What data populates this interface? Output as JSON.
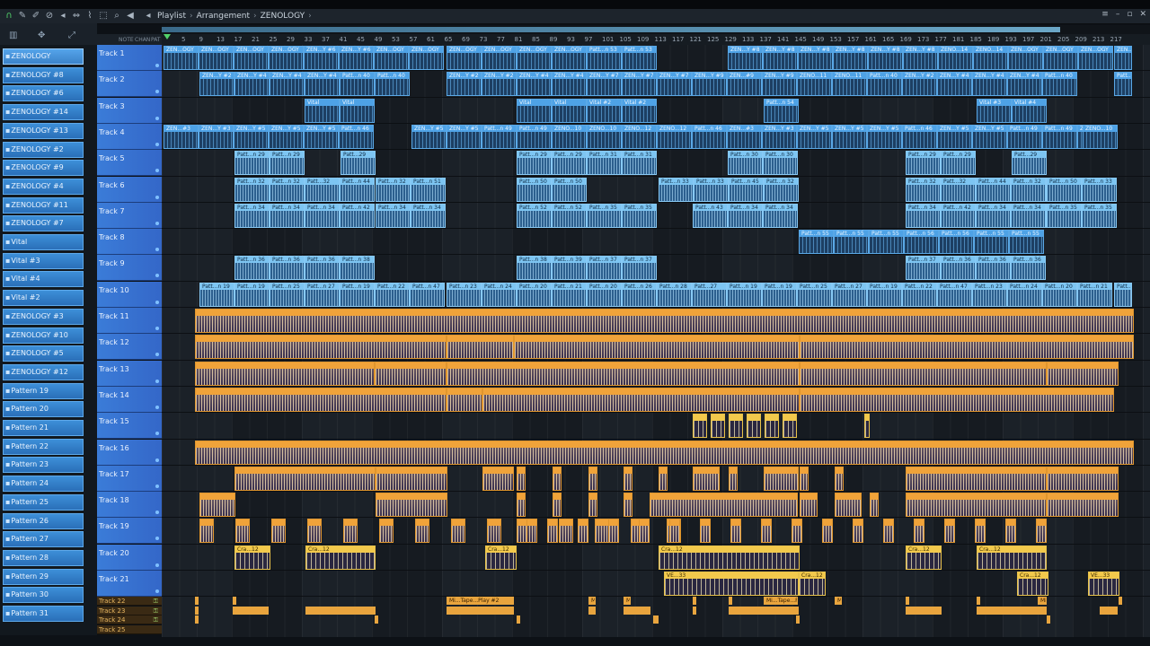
{
  "toolbar": {
    "breadcrumb": [
      "Playlist",
      "Arrangement",
      "ZENOLOGY"
    ],
    "icons": [
      "magnet-icon",
      "draw-icon",
      "paint-icon",
      "delete-icon",
      "mute-icon",
      "slip-icon",
      "slice-icon",
      "select-icon",
      "zoom-icon",
      "playback-icon"
    ]
  },
  "header_left": {
    "labels": [
      "NOTE",
      "CHAN",
      "PAT"
    ]
  },
  "ruler": {
    "ticks": [
      "5",
      "9",
      "13",
      "17",
      "21",
      "25",
      "29",
      "33",
      "37",
      "41",
      "45",
      "49",
      "53",
      "57",
      "61",
      "65",
      "69",
      "73",
      "77",
      "81",
      "85",
      "89",
      "93",
      "97",
      "101",
      "105",
      "109",
      "113",
      "117",
      "121",
      "125",
      "129",
      "133",
      "137",
      "141",
      "145",
      "149",
      "153",
      "157",
      "161",
      "165",
      "169",
      "173",
      "177",
      "181",
      "185",
      "189",
      "193",
      "197",
      "201",
      "205",
      "209",
      "213",
      "217"
    ]
  },
  "browser": {
    "items": [
      "ZENOLOGY",
      "ZENOLOGY #8",
      "ZENOLOGY #6",
      "ZENOLOGY #14",
      "ZENOLOGY #13",
      "ZENOLOGY #2",
      "ZENOLOGY #9",
      "ZENOLOGY #4",
      "ZENOLOGY #11",
      "ZENOLOGY #7",
      "Vital",
      "Vital #3",
      "Vital #4",
      "Vital #2",
      "ZENOLOGY #3",
      "ZENOLOGY #10",
      "ZENOLOGY #5",
      "ZENOLOGY #12",
      "Pattern 19",
      "Pattern 20",
      "Pattern 21",
      "Pattern 22",
      "Pattern 23",
      "Pattern 24",
      "Pattern 25",
      "Pattern 26",
      "Pattern 27",
      "Pattern 28",
      "Pattern 29",
      "Pattern 30",
      "Pattern 31"
    ]
  },
  "tracks": [
    "Track 1",
    "Track 2",
    "Track 3",
    "Track 4",
    "Track 5",
    "Track 6",
    "Track 7",
    "Track 8",
    "Track 9",
    "Track 10",
    "Track 11",
    "Track 12",
    "Track 13",
    "Track 14",
    "Track 15",
    "Track 16",
    "Track 17",
    "Track 18",
    "Track 19",
    "Track 20",
    "Track 21"
  ],
  "small_tracks": [
    "Track 22",
    "Track 23",
    "Track 24",
    "Track 25"
  ],
  "clip_labels": {
    "t1": [
      "ZEN...OGY",
      "ZEN...OGY",
      "ZEN...OGY",
      "ZEN...OGY",
      "ZEN...Y #6",
      "ZEN...Y #6",
      "ZEN...OGY",
      "ZEN...OGY",
      "ZEN...OGY",
      "ZEN...OGY",
      "ZEN...OGY",
      "ZEN...OGY",
      "Patt...n 53",
      "Patt...n 53",
      "ZEN...Y #8",
      "ZEN...Y #8",
      "ZEN...Y #8",
      "ZEN...Y #8",
      "ZEN...Y #8",
      "ZEN...Y #8",
      "ZENO...14",
      "ZENO...14"
    ],
    "t2": [
      "ZEN...Y #2",
      "ZEN...Y #4",
      "ZEN...Y #4",
      "ZEN...Y #4",
      "Patt...n 40",
      "Patt...n 40",
      "ZEN...Y #2",
      "ZEN...Y #2",
      "ZEN...Y #4",
      "ZEN...Y #4",
      "ZEN...Y #7",
      "ZEN...Y #7",
      "ZEN...Y #7",
      "ZEN...Y #9",
      "ZEN...#9",
      "ZEN...Y #9",
      "ZENO...11",
      "ZENO...11",
      "Patt...n 40"
    ],
    "t3": [
      "Vital",
      "Vital",
      "Vital",
      "Vital",
      "Vital #2",
      "Vital #2",
      "Patt...n 54",
      "Vital #3",
      "Vital #4"
    ],
    "t4": [
      "ZEN...#3",
      "ZEN...Y #3",
      "ZEN...Y #5",
      "ZEN...Y #5",
      "ZEN...Y #5",
      "Patt...n 46",
      "ZEN...Y #5",
      "ZEN...Y #5",
      "Patt...n 49",
      "Patt...n 49",
      "ZENO...10",
      "ZENO...10",
      "ZENO...12",
      "ZENO...12",
      "Patt...n 46"
    ],
    "t5": [
      "Patt...n 29",
      "Patt...n 29",
      "Patt...29",
      "Patt...n 29",
      "Patt...n 29",
      "Patt...n 31",
      "Patt...n 31",
      "Patt...n 30",
      "Patt...n 30"
    ],
    "t6": [
      "Patt...n 32",
      "Patt...n 32",
      "Patt...32",
      "Patt...n 44",
      "Patt...n 32",
      "Patt...n 51",
      "Patt...n 50",
      "Patt...n 50",
      "Patt...n 33",
      "Patt...n 33",
      "Patt...n 45"
    ],
    "t7": [
      "Patt...n 34",
      "Patt...n 34",
      "Patt...n 34",
      "Patt...n 42",
      "Patt...n 34",
      "Patt...n 34",
      "Patt...n 52",
      "Patt...n 52",
      "Patt...n 35",
      "Patt...n 35",
      "Patt...n 43"
    ],
    "t8": [
      "Patt...n 55",
      "Patt...n 55",
      "Patt...n 55",
      "Patt...n 56",
      "Patt...n 56",
      "Patt...n 55"
    ],
    "t9": [
      "Patt...n 36",
      "Patt...n 36",
      "Patt...n 36",
      "Patt...n 38",
      "Patt...n 38",
      "Patt...n 39",
      "Patt...n 37",
      "Patt...n 37",
      "Patt...n 37"
    ],
    "t10": [
      "Patt...n 19",
      "Patt...n 19",
      "Patt...n 25",
      "Patt...n 27",
      "Patt...n 19",
      "Patt...n 22",
      "Patt...n 47",
      "Patt...n 23",
      "Patt...n 24",
      "Patt...n 20",
      "Patt...n 21",
      "Patt...n 20",
      "Patt...n 26",
      "Patt...n 28",
      "Patt...27"
    ],
    "t20": [
      "Cra...12"
    ],
    "t21": [
      "VE...33",
      "Cra...12",
      "Cra...12"
    ],
    "t22": [
      "Mi...Tape...Play #2"
    ]
  },
  "colors": {
    "track_header": "#3b7cd8",
    "clip_blue": "#4ea2e6",
    "clip_orange": "#f0a33a",
    "clip_yellow": "#f2c94c",
    "background": "#161b21"
  }
}
